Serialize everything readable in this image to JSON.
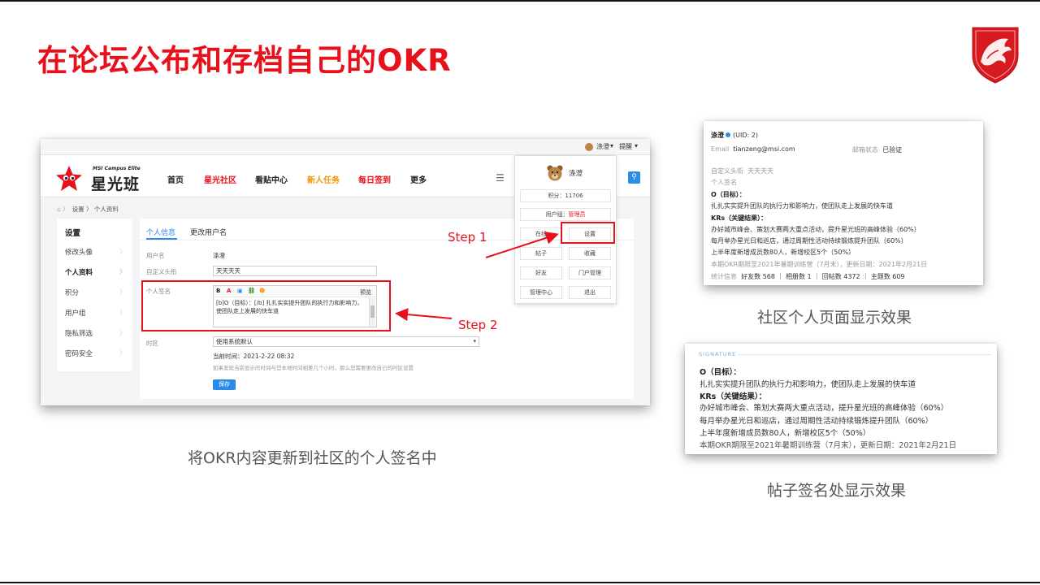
{
  "slide": {
    "title": "在论坛公布和存档自己的OKR",
    "caption_main": "将OKR内容更新到社区的个人签名中",
    "caption_profile": "社区个人页面显示效果",
    "caption_signature": "帖子签名处显示效果",
    "step1": "Step 1",
    "step2": "Step 2",
    "accent_color": "#e8101a"
  },
  "site": {
    "topbar": {
      "user": "涤澄",
      "remind": "提醒"
    },
    "brand_small": "MSI Campus Elite",
    "brand_big": "星光班",
    "nav": [
      {
        "label": "首页",
        "color": "#222222"
      },
      {
        "label": "星光社区",
        "color": "#e8101a"
      },
      {
        "label": "看贴中心",
        "color": "#222222"
      },
      {
        "label": "新人任务",
        "color": "#f39800"
      },
      {
        "label": "每日签到",
        "color": "#e8101a"
      },
      {
        "label": "更多",
        "color": "#222222"
      }
    ],
    "breadcrumb": "设置 〉 个人资料",
    "side": {
      "title": "设置",
      "items": [
        "修改头像",
        "个人资料",
        "积分",
        "用户组",
        "隐私筛选",
        "密码安全"
      ]
    },
    "tabs": [
      "个人信息",
      "更改用户名"
    ],
    "form": {
      "username_label": "用户名",
      "username_value": "涤澄",
      "custom_title_label": "自定义头衔",
      "custom_title_value": "天天天天",
      "signature_label": "个人签名",
      "toolbar_bold": "B",
      "toolbar_preview": "预览",
      "signature_text": "[b]O（目标）：[/b] 扎扎实实提升团队的执行力和影响力，使团队走上发展的快车道",
      "timezone_label": "时区",
      "timezone_value": "使用系统默认",
      "current_time": "当前时间：2021-2-22 08:32",
      "timezone_hint": "如果发现当前显示的时间与您本地时间相差几个小时，那么您需要更改自己的时区设置",
      "save_label": "保存"
    },
    "dropdown": {
      "name": "涤澄",
      "points": "积分：11706",
      "group_prefix": "用户组：",
      "group_value": "管理员",
      "buttons": [
        "在线",
        "设置",
        "帖子",
        "收藏",
        "好友",
        "门户管理",
        "管理中心",
        "退出"
      ]
    }
  },
  "profile_card": {
    "name": "涤澄",
    "uid": "(UID: 2)",
    "email_label": "Email",
    "email_value": "tianzeng@msi.com",
    "email_status_label": "邮箱状态",
    "email_status_value": "已验证",
    "custom_title_label": "自定义头衔",
    "custom_title_value": "天天天天",
    "signature_label": "个人签名",
    "o_title": "O（目标）：",
    "o_text": "扎扎实实提升团队的执行力和影响力，使团队走上发展的快车道",
    "kr_title": "KRs（关键结果）：",
    "kr1": "办好城市峰会、策划大赛两大重点活动，提升星光班的高峰体验（60%）",
    "kr2": "每月举办星光日和巡店，通过周期性活动持续锻炼提升团队（60%）",
    "kr3": "上半年度新增成员数80人，新增校区5个（50%）",
    "period": "本期OKR期限至2021年暑期训练营（7月末），更新日期：2021年2月21日",
    "stats_label": "统计信息",
    "stats": "好友数 568 ｜ 相册数 1 ｜ 回帖数 4372 ｜ 主题数 609"
  },
  "signature_card": {
    "header": "SIGNATURE",
    "o_title": "O（目标）：",
    "o_text": "扎扎实实提升团队的执行力和影响力，使团队走上发展的快车道",
    "kr_title": "KRs（关键结果）：",
    "kr1": "办好城市峰会、策划大赛两大重点活动，提升星光班的高峰体验（60%）",
    "kr2": "每月举办星光日和巡店，通过周期性活动持续锻炼提升团队（60%）",
    "kr3": "上半年度新增成员数80人，新增校区5个（50%）",
    "period": "本期OKR期限至2021年暑期训练营（7月末），更新日期：2021年2月21日"
  }
}
